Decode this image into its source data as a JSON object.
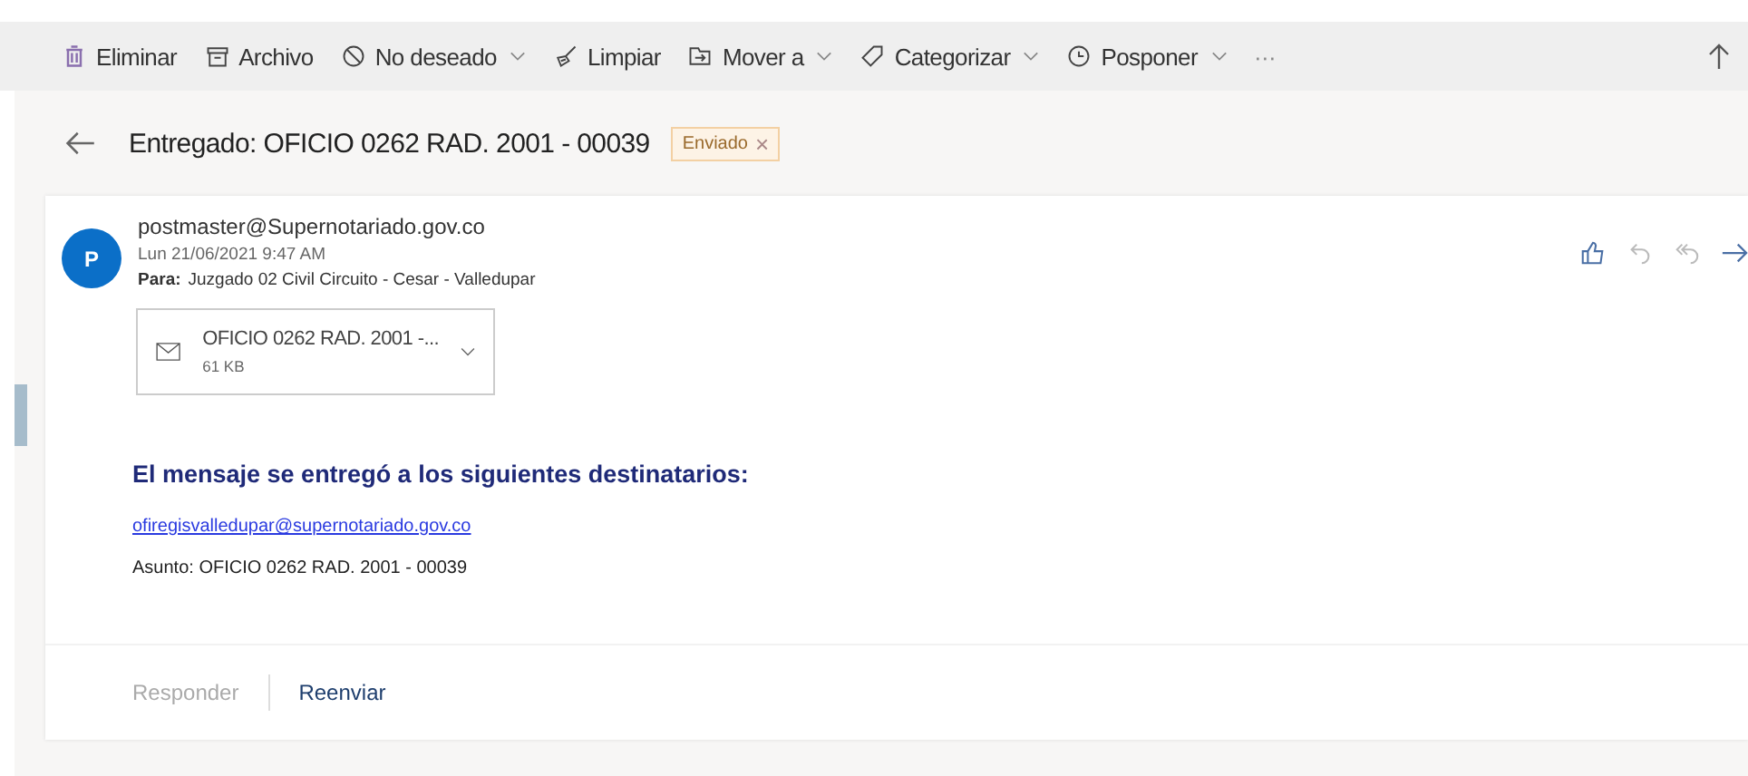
{
  "toolbar": [
    {
      "kind": "trash",
      "label": "Eliminar",
      "dropdown": false
    },
    {
      "kind": "archive",
      "label": "Archivo",
      "dropdown": false
    },
    {
      "kind": "block",
      "label": "No deseado",
      "dropdown": true
    },
    {
      "kind": "broom",
      "label": "Limpiar",
      "dropdown": false
    },
    {
      "kind": "move",
      "label": "Mover a",
      "dropdown": true
    },
    {
      "kind": "tag",
      "label": "Categorizar",
      "dropdown": true
    },
    {
      "kind": "clock",
      "label": "Posponer",
      "dropdown": true
    }
  ],
  "more": "···",
  "subject": "Entregado: OFICIO 0262 RAD. 2001 - 00039",
  "tag": {
    "label": "Enviado",
    "close": "×"
  },
  "message": {
    "avatar": "P",
    "from": "postmaster@Supernotariado.gov.co",
    "date": "Lun 21/06/2021 9:47 AM",
    "to_label": "Para:",
    "to": "Juzgado 02 Civil Circuito - Cesar - Valledupar",
    "actions": [
      {
        "kind": "like",
        "disabled": false
      },
      {
        "kind": "reply",
        "disabled": true
      },
      {
        "kind": "reply-all",
        "disabled": true
      },
      {
        "kind": "forward",
        "disabled": false
      }
    ],
    "attachment": {
      "name": "OFICIO 0262 RAD. 2001 -...",
      "size": "61 KB"
    },
    "heading": "El mensaje se entregó a los siguientes destinatarios:",
    "recipient": "ofiregisvalledupar@supernotariado.gov.co",
    "asunto": "Asunto: OFICIO 0262 RAD. 2001 - 00039"
  },
  "footer": [
    {
      "label": "Responder",
      "disabled": true
    },
    {
      "label": "Reenviar",
      "disabled": false
    }
  ]
}
